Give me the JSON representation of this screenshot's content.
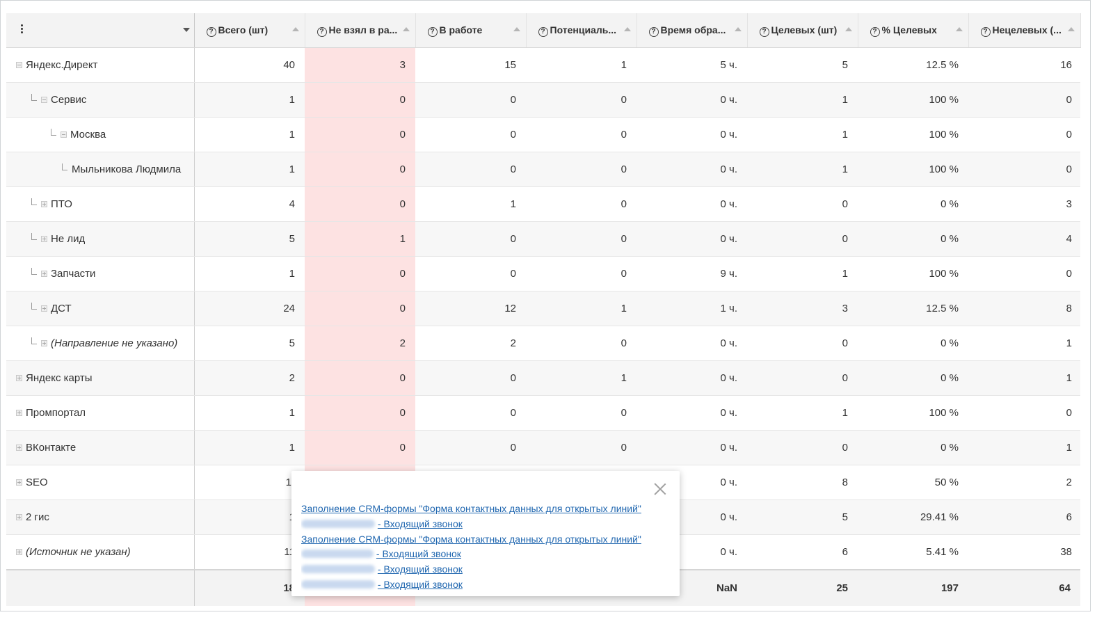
{
  "header": {
    "first_col_icon": "vertical-ellipsis-icon",
    "columns": [
      {
        "label": "Всего (шт)"
      },
      {
        "label": "Не взял в ра..."
      },
      {
        "label": "В работе"
      },
      {
        "label": "Потенциаль..."
      },
      {
        "label": "Время обра..."
      },
      {
        "label": "Целевых (шт)"
      },
      {
        "label": "% Целевых"
      },
      {
        "label": "Нецелевых (..."
      }
    ]
  },
  "colors": {
    "highlight_column": "#fde2e2",
    "link": "#2067b0",
    "header_bg": "#f3f3f3"
  },
  "rows": [
    {
      "name": "Яндекс.Директ",
      "level": 0,
      "italic": false,
      "values": [
        "40",
        "3",
        "15",
        "1",
        "5 ч.",
        "5",
        "12.5 %",
        "16"
      ]
    },
    {
      "name": "Сервис",
      "level": 1,
      "italic": false,
      "values": [
        "1",
        "0",
        "0",
        "0",
        "0 ч.",
        "1",
        "100 %",
        "0"
      ]
    },
    {
      "name": "Москва",
      "level": 2,
      "italic": false,
      "values": [
        "1",
        "0",
        "0",
        "0",
        "0 ч.",
        "1",
        "100 %",
        "0"
      ]
    },
    {
      "name": "Мыльникова Людмила",
      "level": 3,
      "italic": false,
      "values": [
        "1",
        "0",
        "0",
        "0",
        "0 ч.",
        "1",
        "100 %",
        "0"
      ]
    },
    {
      "name": "ПТО",
      "level": 1,
      "italic": false,
      "values": [
        "4",
        "0",
        "1",
        "0",
        "0 ч.",
        "0",
        "0 %",
        "3"
      ]
    },
    {
      "name": "Не лид",
      "level": 1,
      "italic": false,
      "values": [
        "5",
        "1",
        "0",
        "0",
        "0 ч.",
        "0",
        "0 %",
        "4"
      ]
    },
    {
      "name": "Запчасти",
      "level": 1,
      "italic": false,
      "values": [
        "1",
        "0",
        "0",
        "0",
        "9 ч.",
        "1",
        "100 %",
        "0"
      ]
    },
    {
      "name": "ДСТ",
      "level": 1,
      "italic": false,
      "values": [
        "24",
        "0",
        "12",
        "1",
        "1 ч.",
        "3",
        "12.5 %",
        "8"
      ]
    },
    {
      "name": "(Направление не указано)",
      "level": 1,
      "italic": true,
      "values": [
        "5",
        "2",
        "2",
        "0",
        "0 ч.",
        "0",
        "0 %",
        "1"
      ]
    },
    {
      "name": "Яндекс карты",
      "level": 0,
      "italic": false,
      "values": [
        "2",
        "0",
        "0",
        "1",
        "0 ч.",
        "0",
        "0 %",
        "1"
      ]
    },
    {
      "name": "Промпортал",
      "level": 0,
      "italic": false,
      "values": [
        "1",
        "0",
        "0",
        "0",
        "0 ч.",
        "1",
        "100 %",
        "0"
      ]
    },
    {
      "name": "ВКонтакте",
      "level": 0,
      "italic": false,
      "values": [
        "1",
        "0",
        "0",
        "0",
        "0 ч.",
        "0",
        "0 %",
        "1"
      ]
    },
    {
      "name": "SEO",
      "level": 0,
      "italic": false,
      "values": [
        "1(",
        "",
        "",
        "",
        "0 ч.",
        "8",
        "50 %",
        "2"
      ]
    },
    {
      "name": "2 гис",
      "level": 0,
      "italic": false,
      "values": [
        "1",
        "",
        "",
        "",
        "0 ч.",
        "5",
        "29.41 %",
        "6"
      ]
    },
    {
      "name": "(Источник не указан)",
      "level": 0,
      "italic": true,
      "values": [
        "11",
        "",
        "",
        "",
        "0 ч.",
        "6",
        "5.41 %",
        "38"
      ]
    }
  ],
  "totals": [
    "18",
    "",
    "",
    "",
    "NaN",
    "25",
    "197",
    "64"
  ],
  "popup": {
    "close_icon": "close-icon",
    "items": [
      {
        "text": "Заполнение CRM-формы \"Форма контактных данных для открытых линий\"",
        "blurred": false
      },
      {
        "text": "- Входящий звонок",
        "blurred": true
      },
      {
        "text": "Заполнение CRM-формы \"Форма контактных данных для открытых линий\"",
        "blurred": false
      },
      {
        "text": "- Входящий звонок",
        "blurred": true
      },
      {
        "text": "- Входящий звонок",
        "blurred": true
      },
      {
        "text": "- Входящий звонок",
        "blurred": true
      }
    ]
  }
}
